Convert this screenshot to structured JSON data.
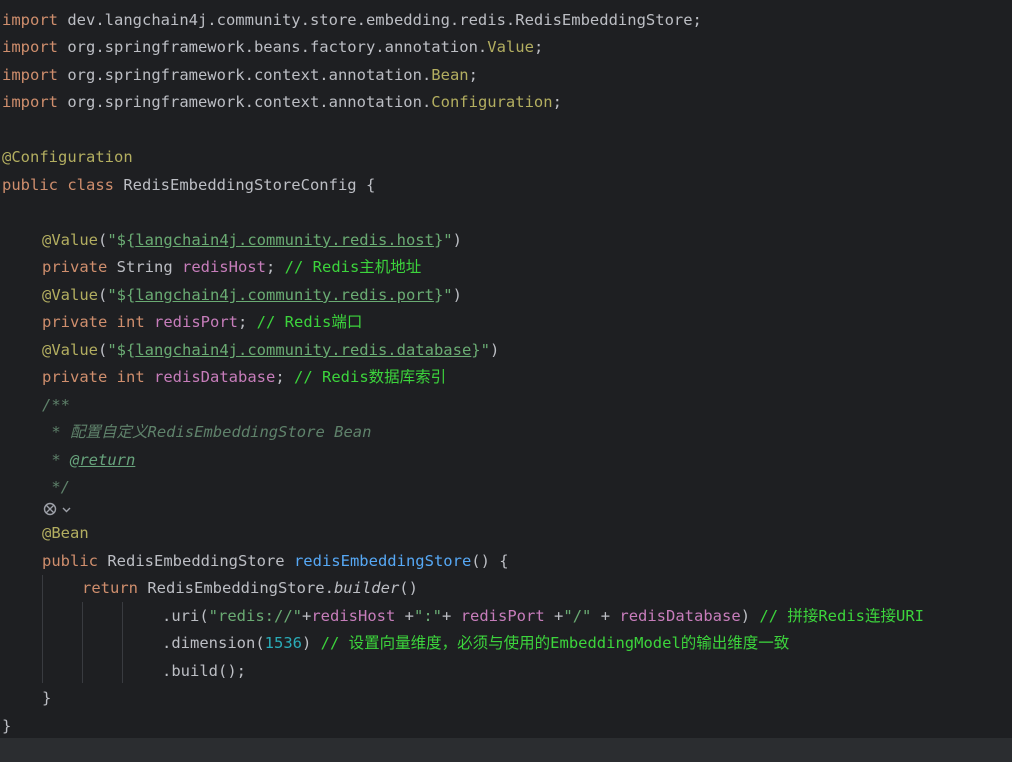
{
  "code": {
    "l1": {
      "kw": "import",
      "rest": " dev.langchain4j.community.store.embedding.redis.RedisEmbeddingStore;"
    },
    "l2": {
      "kw": "import",
      "pre": " org.springframework.beans.factory.annotation.",
      "ann": "Value",
      "post": ";"
    },
    "l3": {
      "kw": "import",
      "pre": " org.springframework.context.annotation.",
      "ann": "Bean",
      "post": ";"
    },
    "l4": {
      "kw": "import",
      "pre": " org.springframework.context.annotation.",
      "ann": "Configuration",
      "post": ";"
    },
    "l6": {
      "ann": "@Configuration"
    },
    "l7": {
      "kw1": "public",
      "kw2": " class",
      "rest": " RedisEmbeddingStoreConfig {"
    },
    "l9": {
      "ann": "@Value",
      "open": "(",
      "q1": "\"${",
      "link": "langchain4j.community.redis.host",
      "q2": "}\"",
      "close": ")"
    },
    "l10": {
      "kw": "private",
      "type": " String ",
      "field": "redisHost",
      "semi": "; ",
      "cmt": "// Redis主机地址"
    },
    "l11": {
      "ann": "@Value",
      "open": "(",
      "q1": "\"${",
      "link": "langchain4j.community.redis.port",
      "q2": "}\"",
      "close": ")"
    },
    "l12": {
      "kw": "private",
      "type": " int ",
      "field": "redisPort",
      "semi": "; ",
      "cmt": "// Redis端口"
    },
    "l13": {
      "ann": "@Value",
      "open": "(",
      "q1": "\"${",
      "link": "langchain4j.community.redis.database",
      "q2": "}\"",
      "close": ")"
    },
    "l14": {
      "kw": "private",
      "type": " int ",
      "field": "redisDatabase",
      "semi": "; ",
      "cmt": "// Redis数据库索引"
    },
    "l15": {
      "doc": "/**"
    },
    "l16": {
      "doc": " * 配置自定义RedisEmbeddingStore Bean"
    },
    "l17": {
      "doc": " * ",
      "tag": "@return"
    },
    "l18": {
      "doc": " */"
    },
    "l19": {
      "ann": "@Bean"
    },
    "l20": {
      "kw": "public",
      "rest": " RedisEmbeddingStore ",
      "fn": "redisEmbeddingStore",
      "tail": "() {"
    },
    "l21": {
      "kw": "return",
      "rest": " RedisEmbeddingStore.",
      "it": "builder",
      "tail": "()"
    },
    "l22": {
      "a": ".uri(",
      "s1": "\"redis://\"",
      "b": "+",
      "f1": "redisHost",
      "c": " +",
      "s2": "\":\"",
      "d": "+ ",
      "f2": "redisPort",
      "e": " +",
      "s3": "\"/\"",
      "g": " + ",
      "f3": "redisDatabase",
      "h": ") ",
      "cmt": "// 拼接Redis连接URI"
    },
    "l23": {
      "a": ".dimension(",
      "num": "1536",
      "b": ") ",
      "cmt": "// 设置向量维度，必须与使用的EmbeddingModel的输出维度一致"
    },
    "l24": {
      "a": ".build();"
    },
    "l25": {
      "a": "}"
    },
    "l26": {
      "a": "}"
    }
  },
  "gutter": {
    "icon": "bean-gutter-icon"
  },
  "colors": {
    "background": "#1e1f22",
    "keyword": "#cf8e6d",
    "annotation": "#b3ae60",
    "string": "#6aab73",
    "field": "#c77dbb",
    "method": "#56a8f5",
    "number": "#2aacb8",
    "comment": "#3cd43c",
    "doc": "#5f826b"
  }
}
